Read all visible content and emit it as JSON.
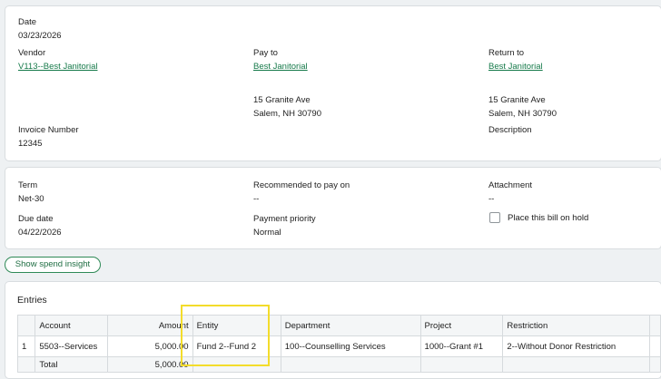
{
  "header_card": {
    "date_label": "Date",
    "date_value": "03/23/2026",
    "vendor_label": "Vendor",
    "vendor_value": "V113--Best Janitorial",
    "payto_label": "Pay to",
    "payto_name": "Best Janitorial",
    "payto_address1": "15 Granite Ave",
    "payto_address2": "Salem, NH 30790",
    "return_label": "Return to",
    "return_name": "Best Janitorial",
    "return_address1": "15 Granite Ave",
    "return_address2": "Salem, NH 30790",
    "invoice_label": "Invoice Number",
    "invoice_value": "12345",
    "description_label": "Description"
  },
  "terms_card": {
    "term_label": "Term",
    "term_value": "Net-30",
    "recommended_label": "Recommended to pay on",
    "recommended_value": "--",
    "attachment_label": "Attachment",
    "attachment_value": "--",
    "due_label": "Due date",
    "due_value": "04/22/2026",
    "priority_label": "Payment priority",
    "priority_value": "Normal",
    "hold_label": "Place this bill on hold"
  },
  "spend_insight_label": "Show spend insight",
  "entries": {
    "title": "Entries",
    "columns": [
      "",
      "Account",
      "Amount",
      "Entity",
      "Department",
      "Project",
      "Restriction"
    ],
    "rows": [
      {
        "num": "1",
        "account": "5503--Services",
        "amount": "5,000.00",
        "entity": "Fund 2--Fund 2",
        "department": "100--Counselling Services",
        "project": "1000--Grant #1",
        "restriction": "2--Without Donor Restriction"
      }
    ],
    "total_label": "Total",
    "total_amount": "5,000.00"
  },
  "colors": {
    "link": "#167a4a",
    "highlight": "#f3dc2b"
  }
}
